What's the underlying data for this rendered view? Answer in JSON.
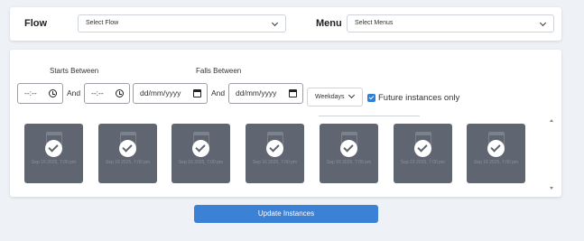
{
  "header": {
    "flow_label": "Flow",
    "flow_select_value": "Select Flow",
    "menu_label": "Menu",
    "menu_select_value": "Select Menus"
  },
  "filters": {
    "starts_between_label": "Starts Between",
    "falls_between_label": "Falls Between",
    "start_time_from": "--:--",
    "start_time_to": "--:--",
    "and_label": "And",
    "date_from": "dd/mm/yyyy",
    "date_to": "dd/mm/yyyy",
    "weekdays_value": "Weekdays",
    "future_only_label": "Future instances only",
    "future_only_checked": true
  },
  "instances": [
    {
      "date": "Sep 16 2025, 7:00 pm"
    },
    {
      "date": "Sep 16 2025, 7:00 pm"
    },
    {
      "date": "Sep 16 2025, 7:00 pm"
    },
    {
      "date": "Sep 16 2025, 7:00 pm"
    },
    {
      "date": "Sep 16 2025, 7:00 pm"
    },
    {
      "date": "Sep 16 2025, 7:00 pm"
    },
    {
      "date": "Sep 16 2025, 7:00 pm"
    }
  ],
  "actions": {
    "update_label": "Update Instances"
  },
  "colors": {
    "accent": "#3b82d6",
    "tile_bg": "#5f6672",
    "page_bg": "#eef1f6"
  }
}
